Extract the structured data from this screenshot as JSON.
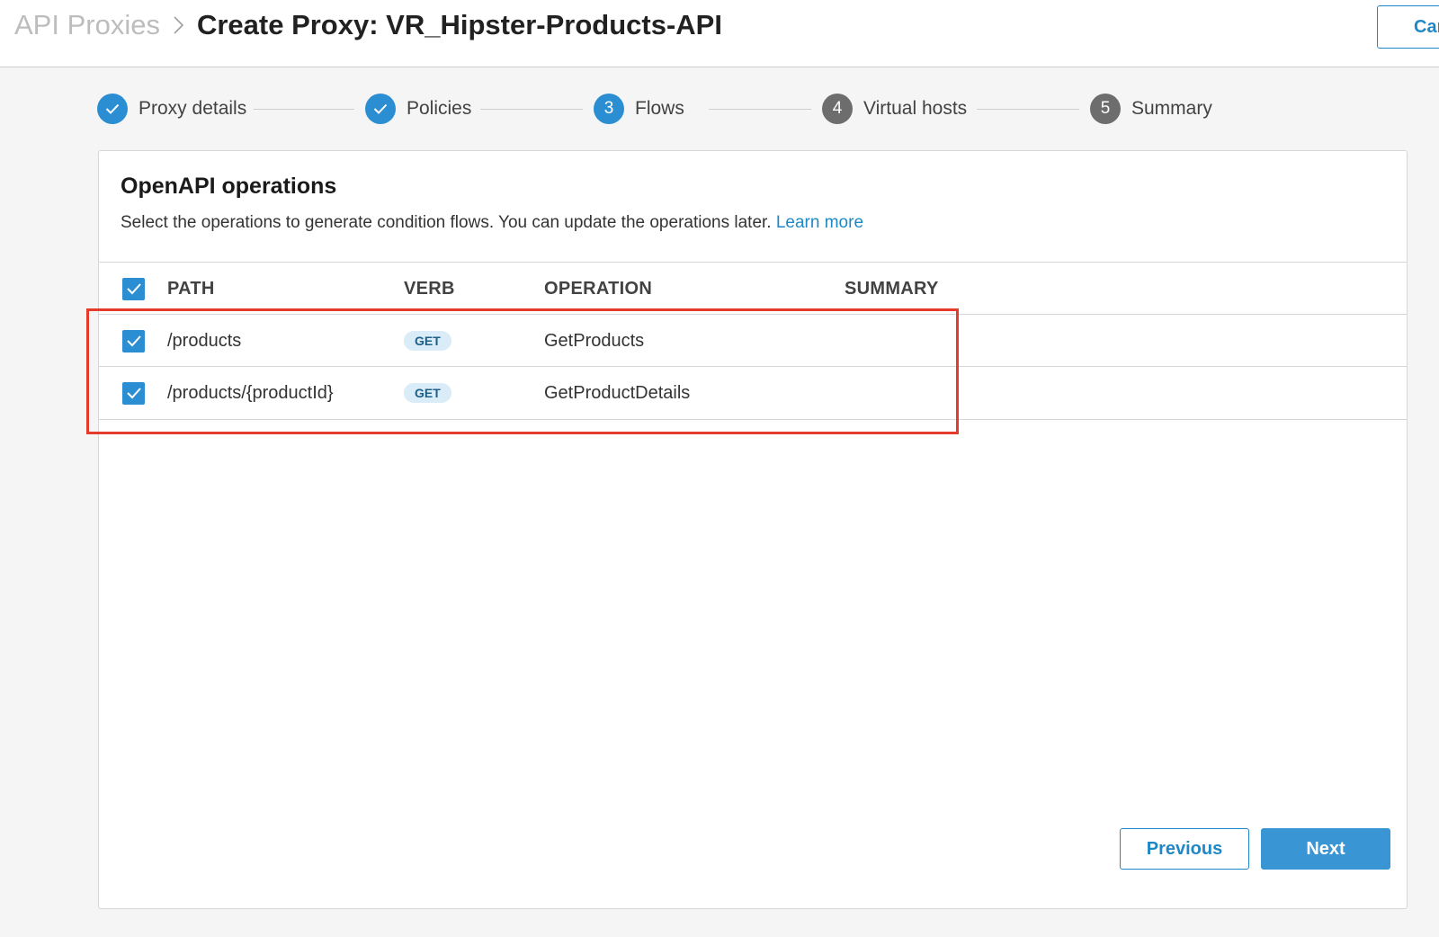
{
  "header": {
    "breadcrumb_parent": "API Proxies",
    "title": "Create Proxy: VR_Hipster-Products-API",
    "cancel_label": "Cancel"
  },
  "stepper": {
    "steps": [
      {
        "number": "1",
        "label": "Proxy details",
        "state": "done"
      },
      {
        "number": "2",
        "label": "Policies",
        "state": "done"
      },
      {
        "number": "3",
        "label": "Flows",
        "state": "active"
      },
      {
        "number": "4",
        "label": "Virtual hosts",
        "state": "pending"
      },
      {
        "number": "5",
        "label": "Summary",
        "state": "pending"
      }
    ]
  },
  "card": {
    "title": "OpenAPI operations",
    "description": "Select the operations to generate condition flows. You can update the operations later.",
    "learn_more": "Learn more",
    "columns": {
      "path": "PATH",
      "verb": "VERB",
      "operation": "OPERATION",
      "summary": "SUMMARY"
    },
    "rows": [
      {
        "path": "/products",
        "verb": "GET",
        "operation": "GetProducts",
        "summary": "",
        "checked": true
      },
      {
        "path": "/products/{productId}",
        "verb": "GET",
        "operation": "GetProductDetails",
        "summary": "",
        "checked": true
      }
    ],
    "select_all_checked": true
  },
  "footer": {
    "previous_label": "Previous",
    "next_label": "Next"
  },
  "colors": {
    "accent": "#2b8ed2",
    "highlight": "#e53b2c",
    "pending_step": "#6d6d6d"
  }
}
